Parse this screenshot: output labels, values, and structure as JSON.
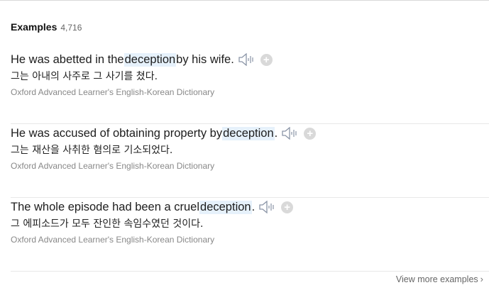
{
  "examples_section": {
    "title": "Examples",
    "count": "4,716"
  },
  "examples": [
    {
      "en_before": "He was abetted in the ",
      "en_highlight": "deception",
      "en_after": " by his wife.",
      "ko": "그는 아내의 사주로 그 사기를 쳤다.",
      "source": "Oxford Advanced Learner's English-Korean Dictionary"
    },
    {
      "en_before": "He was accused of obtaining property by ",
      "en_highlight": "deception",
      "en_after": ".",
      "ko": "그는 재산을 사취한 혐의로 기소되었다.",
      "source": "Oxford Advanced Learner's English-Korean Dictionary"
    },
    {
      "en_before": "The whole episode had been a cruel ",
      "en_highlight": "deception",
      "en_after": ".",
      "ko": "그 에피소드가 모두 잔인한 속임수였던 것이다.",
      "source": "Oxford Advanced Learner's English-Korean Dictionary"
    }
  ],
  "icons": {
    "speaker": "speaker-icon",
    "add": "plus-circle-icon",
    "chevron": "chevron-right-icon"
  },
  "view_more": {
    "label": "View more examples",
    "chevron": "›"
  },
  "colors": {
    "highlight_bg": "#e6f1fb",
    "source_text": "#888888",
    "plus_bg": "#d9d9d9"
  },
  "plus_glyph": "+"
}
